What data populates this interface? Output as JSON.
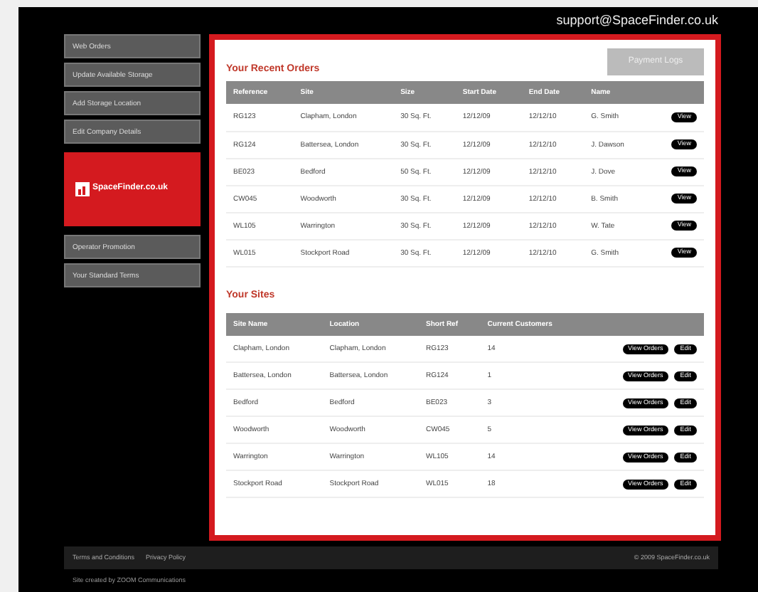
{
  "header": {
    "email": "support@SpaceFinder.co.uk"
  },
  "sidebar": {
    "items": [
      {
        "label": "Web Orders"
      },
      {
        "label": "Update Available Storage"
      },
      {
        "label": "Add Storage Location"
      },
      {
        "label": "Edit Company Details"
      }
    ],
    "logo": "SpaceFinder.co.uk",
    "lower_items": [
      {
        "label": "Operator Promotion"
      },
      {
        "label": "Your Standard Terms"
      }
    ]
  },
  "payment_button": "Payment Logs",
  "orders": {
    "title": "Your Recent Orders",
    "columns": [
      "Reference",
      "Site",
      "Size",
      "Start Date",
      "End Date",
      "Name"
    ],
    "rows": [
      {
        "cells": [
          "RG123",
          "Clapham, London",
          "30 Sq. Ft.",
          "12/12/09",
          "12/12/10",
          "G. Smith"
        ],
        "actions": [
          "View"
        ]
      },
      {
        "cells": [
          "RG124",
          "Battersea, London",
          "30 Sq. Ft.",
          "12/12/09",
          "12/12/10",
          "J. Dawson"
        ],
        "actions": [
          "View"
        ]
      },
      {
        "cells": [
          "BE023",
          "Bedford",
          "50 Sq. Ft.",
          "12/12/09",
          "12/12/10",
          "J. Dove"
        ],
        "actions": [
          "View"
        ]
      },
      {
        "cells": [
          "CW045",
          "Woodworth",
          "30 Sq. Ft.",
          "12/12/09",
          "12/12/10",
          "B. Smith"
        ],
        "actions": [
          "View"
        ]
      },
      {
        "cells": [
          "WL105",
          "Warrington",
          "30 Sq. Ft.",
          "12/12/09",
          "12/12/10",
          "W. Tate"
        ],
        "actions": [
          "View"
        ]
      },
      {
        "cells": [
          "WL015",
          "Stockport Road",
          "30 Sq. Ft.",
          "12/12/09",
          "12/12/10",
          "G. Smith"
        ],
        "actions": [
          "View"
        ]
      }
    ]
  },
  "sites": {
    "title": "Your Sites",
    "columns": [
      "Site Name",
      "Location",
      "Short Ref",
      "Current Customers"
    ],
    "rows": [
      {
        "cells": [
          "Clapham, London",
          "Clapham, London",
          "RG123",
          "14"
        ],
        "actions": [
          "View Orders",
          "Edit"
        ]
      },
      {
        "cells": [
          "Battersea, London",
          "Battersea, London",
          "RG124",
          "1"
        ],
        "actions": [
          "View Orders",
          "Edit"
        ]
      },
      {
        "cells": [
          "Bedford",
          "Bedford",
          "BE023",
          "3"
        ],
        "actions": [
          "View Orders",
          "Edit"
        ]
      },
      {
        "cells": [
          "Woodworth",
          "Woodworth",
          "CW045",
          "5"
        ],
        "actions": [
          "View Orders",
          "Edit"
        ]
      },
      {
        "cells": [
          "Warrington",
          "Warrington",
          "WL105",
          "14"
        ],
        "actions": [
          "View Orders",
          "Edit"
        ]
      },
      {
        "cells": [
          "Stockport Road",
          "Stockport Road",
          "WL015",
          "18"
        ],
        "actions": [
          "View Orders",
          "Edit"
        ]
      }
    ]
  },
  "footer": {
    "links": [
      "Terms and Conditions",
      "Privacy Policy"
    ],
    "copyright": "© 2009 SpaceFinder.co.uk",
    "credit": "Site created by ZOOM Communications"
  }
}
